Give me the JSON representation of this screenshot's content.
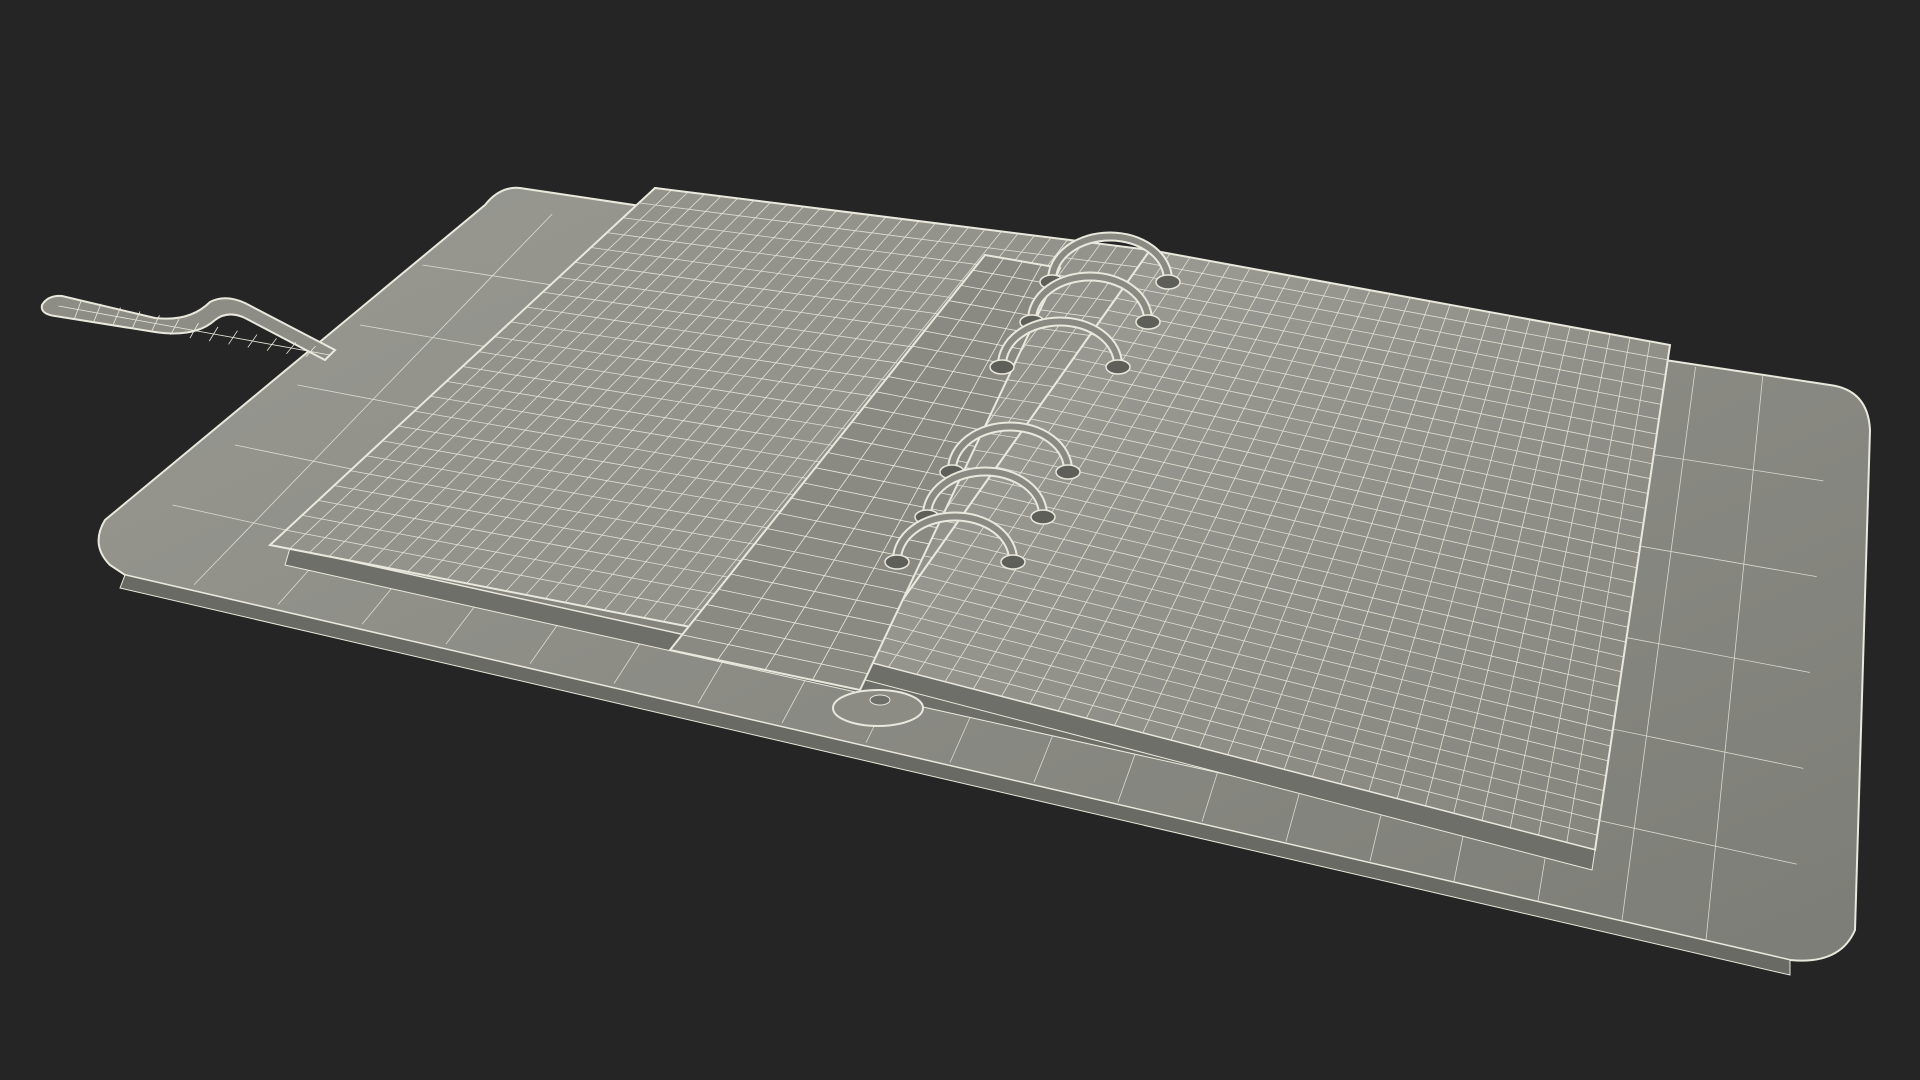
{
  "scene": {
    "subject": "planner-organizer-wireframe",
    "render_style": "wireframe",
    "colors": {
      "background": "#252525",
      "surface": "#8c8c85",
      "surface_light": "#a3a39c",
      "surface_dark": "#6f6f69",
      "wire": "#e8e8dc",
      "shadow": "#3a3a38"
    },
    "parts": [
      "base-cover",
      "strap-tab",
      "back-pages",
      "front-pages",
      "ring-mechanism",
      "rings",
      "button-snap"
    ],
    "ring_count": 6
  }
}
